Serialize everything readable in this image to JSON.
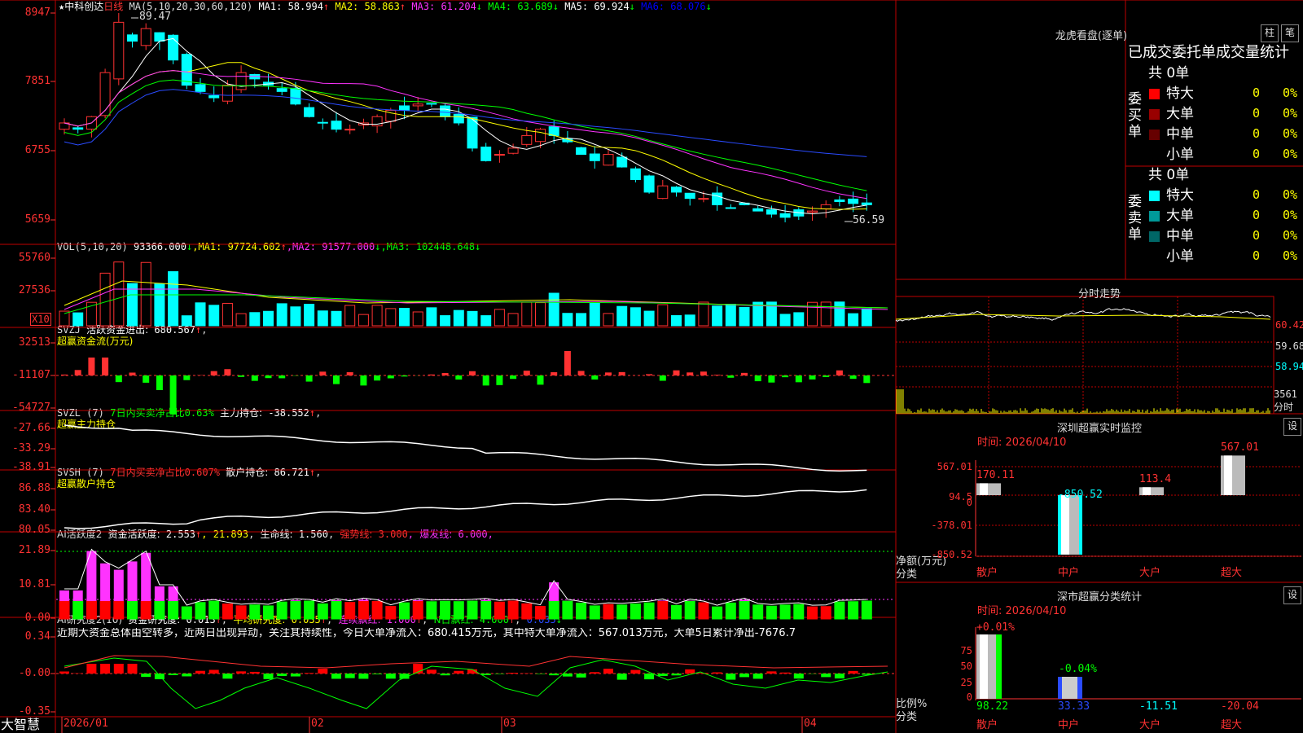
{
  "app": {
    "logo": "大智慧",
    "period": "日线"
  },
  "kline": {
    "stock_name": "中科创达",
    "ma_label": "MA(5,10,20,30,60,120)",
    "ma": [
      {
        "name": "MA1",
        "value": "58.994",
        "arrow": "↑",
        "color": "#ffffff"
      },
      {
        "name": "MA2",
        "value": "58.863",
        "arrow": "↑",
        "color": "#ffff00"
      },
      {
        "name": "MA3",
        "value": "61.204",
        "arrow": "↓",
        "color": "#ff33ff"
      },
      {
        "name": "MA4",
        "value": "63.689",
        "arrow": "↓",
        "color": "#00ff00"
      },
      {
        "name": "MA5",
        "value": "69.924",
        "arrow": "↓",
        "color": "#ffffff"
      },
      {
        "name": "MA6",
        "value": "68.076",
        "arrow": "↓",
        "color": "#0000ff"
      }
    ],
    "axis": [
      "8947",
      "7851",
      "6755",
      "5659"
    ],
    "high_label": "89.47",
    "low_label": "56.59",
    "ylim": [
      54.5,
      91
    ]
  },
  "vol": {
    "title": "VOL(5,10,20)",
    "value": "93366.000",
    "arrow": "↓",
    "ma1": "97724.602",
    "ma1_arrow": "↑",
    "ma2": "91577.000",
    "ma2_arrow": "↓",
    "ma3": "102448.648",
    "ma3_arrow": "↓",
    "axis": [
      "55760",
      "27536"
    ],
    "unit": "X10"
  },
  "svzj": {
    "title": "SVZJ",
    "label": "活跃资金进出:",
    "value": "680.567",
    "arrow": "↑",
    "sub": "超赢资金流(万元)",
    "axis": [
      "32513",
      "-11107",
      "-54727"
    ]
  },
  "svzl": {
    "title": "SVZL (7)",
    "label": "7日内买卖净占比",
    "pct": "0.63%",
    "hold_label": "主力持仓:",
    "hold": "-38.552",
    "arrow": "↑",
    "sub": "超赢主力持仓",
    "axis": [
      "-27.66",
      "-33.29",
      "-38.91"
    ]
  },
  "svsh": {
    "title": "SVSH (7)",
    "label": "7日内买卖净占比",
    "pct": "0.607%",
    "hold_label": "散户持仓:",
    "hold": "86.721",
    "arrow": "↑",
    "sub": "超赢散户持仓",
    "axis": [
      "86.88",
      "83.40",
      "80.05"
    ]
  },
  "ai1": {
    "title": "AI活跃度2",
    "l1": "资金活跃度:",
    "v1": "2.553",
    "a1": "↑",
    "v2": "21.893",
    "l3": "生命线:",
    "v3": "1.560",
    "l4": "强势线:",
    "v4": "3.000",
    "l5": "爆发线:",
    "v5": "6.000",
    "axis": [
      "21.89",
      "10.81",
      "0.00"
    ]
  },
  "ai2": {
    "title": "AI研究度2(10)",
    "l1": "资金研究度:",
    "v1": "0.013",
    "a1": "↑",
    "l2": "平均研究度:",
    "v2": "0.035",
    "a2": "↑",
    "l3": "连续飘红:",
    "v3": "1.000",
    "a3": "↑",
    "l4": "N日飘红:",
    "v4": "4.000",
    "a4": "↑",
    "v5": "0.035",
    "a5": "↓",
    "comment": "近期大资金总体由空转多，近两日出现异动，关注其持续性，今日大单净流入：680.415万元，其中特大单净流入：567.013万元，大单5日累计净出-7676.7",
    "axis": [
      "0.34",
      "-0.00",
      "-0.35"
    ]
  },
  "xaxis": [
    "2026/01",
    "02",
    "03",
    "04"
  ],
  "longhu": {
    "title": "龙虎看盘(逐单)",
    "btn1": "柱",
    "btn2": "笔",
    "header": "已成交委托单成交量统计",
    "buy_label": "委买单",
    "sell_label": "委卖单",
    "total": "共 0单",
    "rows": [
      {
        "name": "特大",
        "count": "0",
        "pct": "0%"
      },
      {
        "name": "大单",
        "count": "0",
        "pct": "0%"
      },
      {
        "name": "中单",
        "count": "0",
        "pct": "0%"
      },
      {
        "name": "小单",
        "count": "0",
        "pct": "0%"
      }
    ],
    "buy_colors": [
      "#ff0000",
      "#990000",
      "#660000",
      ""
    ],
    "sell_colors": [
      "#00ffff",
      "#009999",
      "#006666",
      ""
    ]
  },
  "fenshi": {
    "title": "分时走势",
    "axis": [
      "60.42",
      "59.68",
      "58.94"
    ],
    "vol_axis": "3561",
    "vol_unit": "分时"
  },
  "monitor": {
    "title": "深圳超赢实时监控",
    "btn": "设",
    "time": "时间: 2026/04/10",
    "axis": [
      "567.01",
      "94.5",
      "0",
      "-378.01",
      "-850.52"
    ],
    "ylabel": "净额(万元)",
    "xlabel": "分类",
    "categories": [
      "散户",
      "中户",
      "大户",
      "超大"
    ],
    "values": [
      170.11,
      -850.52,
      113.4,
      567.01
    ],
    "labels": [
      "170.11",
      "-850.52",
      "113.4",
      "567.01"
    ]
  },
  "classify": {
    "title": "深市超赢分类统计",
    "btn": "设",
    "time": "时间: 2026/04/10",
    "axis": [
      "75",
      "50",
      "25",
      "0"
    ],
    "ylabel": "比例%",
    "xlabel": "分类",
    "categories": [
      "散户",
      "中户",
      "大户",
      "超大"
    ],
    "top_labels": [
      "+0.01%",
      "-0.04%"
    ],
    "values": [
      "98.22",
      "33.33",
      "-11.51",
      "-20.04"
    ]
  }
}
